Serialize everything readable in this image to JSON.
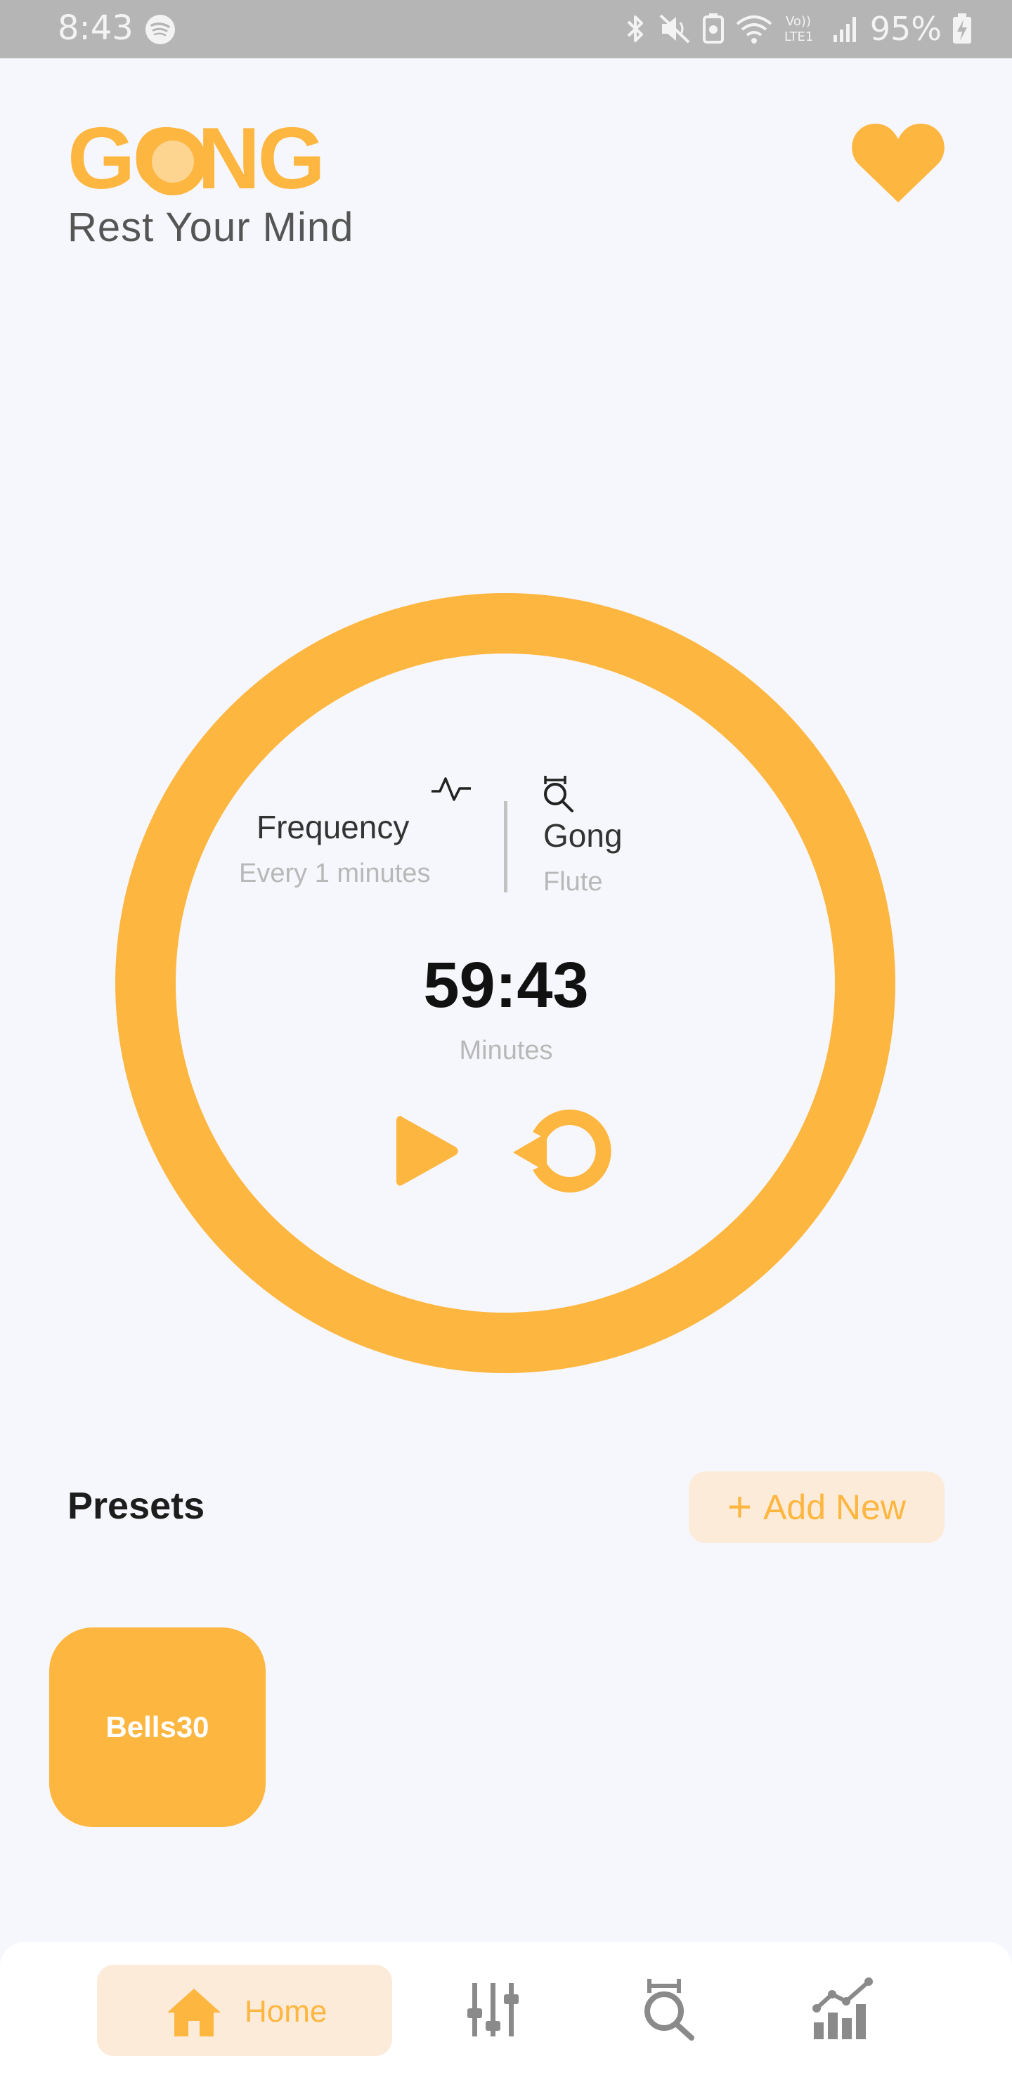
{
  "status_bar": {
    "time": "8:43",
    "battery_percent": "95%",
    "icons": [
      "spotify-icon",
      "bluetooth-icon",
      "mute-icon",
      "battery-saver-icon",
      "wifi-icon",
      "volte-lte-icon",
      "signal-icon",
      "battery-charging-icon"
    ],
    "volte_label_top": "Vo))",
    "volte_label_bottom": "LTE1"
  },
  "header": {
    "logo_text": "GONG",
    "tagline": "Rest Your Mind",
    "favorite_icon": "heart-icon"
  },
  "timer_card": {
    "frequency_label": "Frequency",
    "frequency_value": "Every 1 minutes",
    "frequency_icon": "pulse-icon",
    "sound_label": "Gong",
    "sound_value": "Flute",
    "sound_icon": "gong-icon",
    "time_remaining": "59:43",
    "time_unit": "Minutes",
    "play_icon": "play-icon",
    "reset_icon": "reset-icon"
  },
  "presets": {
    "title": "Presets",
    "add_new_label": "Add New",
    "items": [
      {
        "label": "Bells30"
      }
    ]
  },
  "bottom_nav": {
    "items": [
      {
        "label": "Home",
        "icon": "home-icon",
        "active": true
      },
      {
        "label": "",
        "icon": "mixer-icon",
        "active": false
      },
      {
        "label": "",
        "icon": "gong-icon",
        "active": false
      },
      {
        "label": "",
        "icon": "stats-icon",
        "active": false
      }
    ]
  },
  "colors": {
    "accent": "#fdb640",
    "accent_light": "#fcebd9",
    "background": "#f6f7fc",
    "status_bar": "#b5b5b5"
  }
}
